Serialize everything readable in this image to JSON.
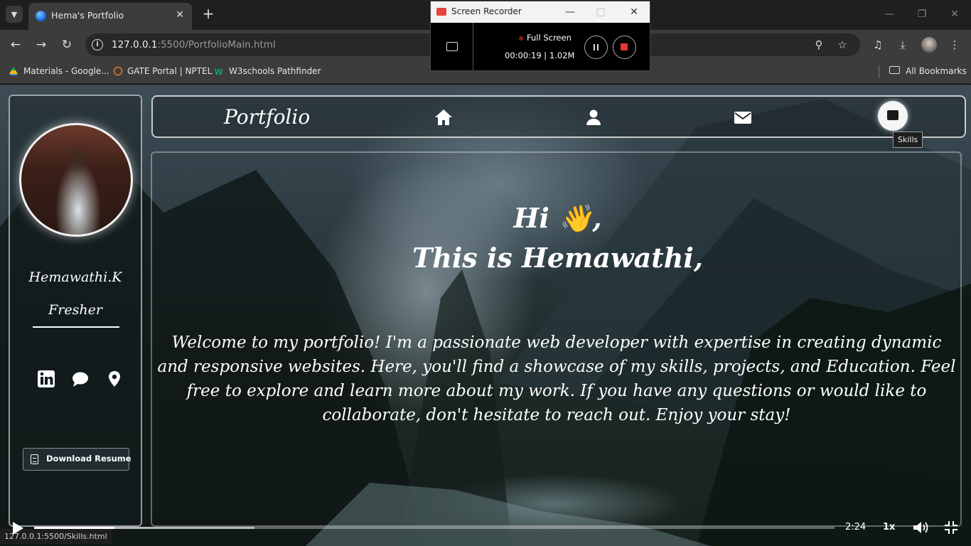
{
  "browser": {
    "tab_title": "Hema's Portfolio",
    "url_host": "127.0.0.1",
    "url_path": ":5500/PortfolioMain.html",
    "bookmarks": [
      {
        "label": "Materials - Google..."
      },
      {
        "label": "GATE Portal | NPTEL"
      },
      {
        "label": "W3schools Pathfinder"
      }
    ],
    "all_bookmarks": "All Bookmarks",
    "status_url": "127.0.0.1:5500/Skills.html"
  },
  "recorder": {
    "title": "Screen Recorder",
    "mode": "Full Screen",
    "elapsed": "00:00:19",
    "size": "1.02M"
  },
  "portfolio": {
    "brand": "Portfolio",
    "nav_tooltip": "Skills",
    "profile": {
      "name": "Hemawathi.K",
      "role": "Fresher",
      "download_label": "Download Resume"
    },
    "hero": {
      "greeting": "Hi 👋,",
      "headline": "This is Hemawathi,",
      "intro": "Welcome to my portfolio! I'm a passionate web developer with expertise in creating dynamic and responsive websites. Here, you'll find a showcase of my skills, projects, and Education. Feel free to explore and learn more about my work. If you have any questions or would like to collaborate, don't hesitate to reach out. Enjoy your stay!"
    }
  },
  "player": {
    "time": "2:24",
    "speed": "1x",
    "progress": 0.1,
    "buffered": 0.275
  },
  "icons": {
    "nav": [
      "home-icon",
      "user-icon",
      "envelope-icon",
      "skills-icon"
    ],
    "social": [
      "linkedin-icon",
      "chat-icon",
      "location-pin-icon"
    ]
  }
}
